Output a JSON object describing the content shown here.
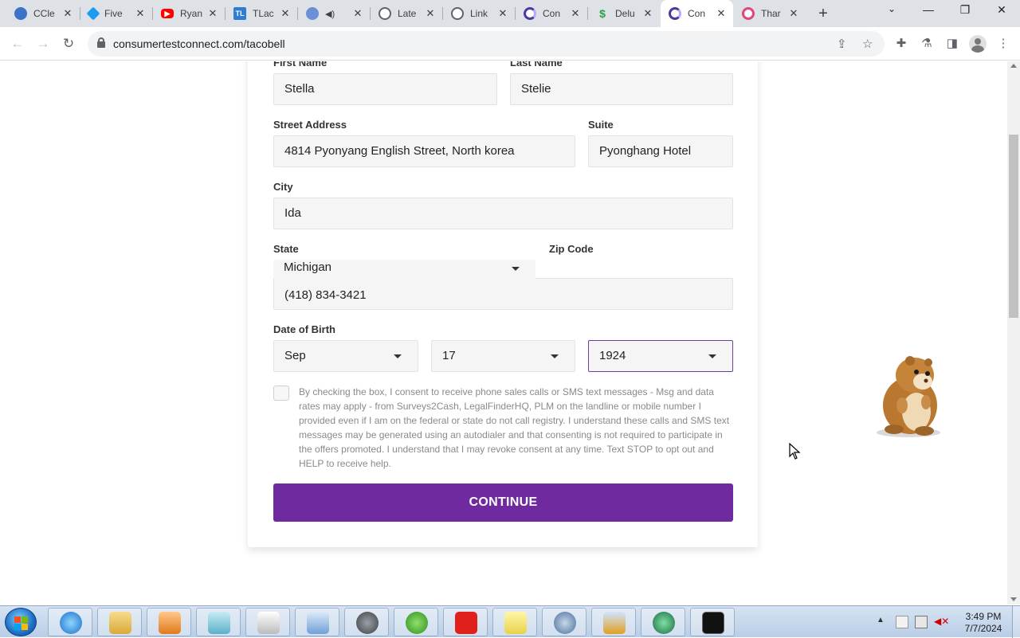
{
  "browser": {
    "tabs": [
      {
        "title": "CCle",
        "icon": "ccleaner-icon",
        "color": "#3b73c6"
      },
      {
        "title": "Five",
        "icon": "fiverr-icon",
        "color": "#1d9bf0"
      },
      {
        "title": "Ryan",
        "icon": "youtube-icon",
        "color": "#ff0000"
      },
      {
        "title": "TLac",
        "icon": "tl-icon",
        "color": "#2d7dd2",
        "glyph": "TL"
      },
      {
        "title": "",
        "icon": "audio-tab-icon",
        "color": "#6b8fd4"
      },
      {
        "title": "Late",
        "icon": "globe-icon",
        "color": "#5f6368"
      },
      {
        "title": "Link",
        "icon": "globe-icon",
        "color": "#5f6368"
      },
      {
        "title": "Con",
        "icon": "swirl-icon",
        "color": "#4a3aa0"
      },
      {
        "title": "Delu",
        "icon": "dollar-icon",
        "color": "#2aa04a"
      },
      {
        "title": "Con",
        "icon": "swirl-icon",
        "color": "#4a3aa0"
      },
      {
        "title": "Thar",
        "icon": "ring-icon",
        "color": "#e0457b"
      }
    ],
    "active_tab_index": 9,
    "url": "consumertestconnect.com/tacobell"
  },
  "form": {
    "first_name": {
      "label": "First Name",
      "value": "Stella"
    },
    "last_name": {
      "label": "Last Name",
      "value": "Stelie"
    },
    "street": {
      "label": "Street Address",
      "value": "4814 Pyonyang English Street, North korea"
    },
    "suite": {
      "label": "Suite",
      "value": "Pyonghang Hotel"
    },
    "city": {
      "label": "City",
      "value": "Ida"
    },
    "state": {
      "label": "State",
      "value": "Michigan"
    },
    "zip": {
      "label": "Zip Code",
      "value": ""
    },
    "phone": {
      "value": "(418) 834-3421"
    },
    "dob": {
      "label": "Date of Birth",
      "month": "Sep",
      "day": "17",
      "year": "1924"
    },
    "consent_text": "By checking the box, I consent to receive phone sales calls or SMS text messages - Msg and data rates may apply - from Surveys2Cash, LegalFinderHQ, PLM on the landline or mobile number I provided even if I am on the federal or state do not call registry. I understand these calls and SMS text messages may be generated using an autodialer and that consenting is not required to participate in the offers promoted. I understand that I may revoke consent at any time. Text STOP to opt out and HELP to receive help.",
    "consent_checked": false,
    "continue_label": "CONTINUE",
    "accent_color": "#702a9f"
  },
  "taskbar": {
    "clock_time": "3:49 PM",
    "clock_date": "7/7/2024"
  }
}
